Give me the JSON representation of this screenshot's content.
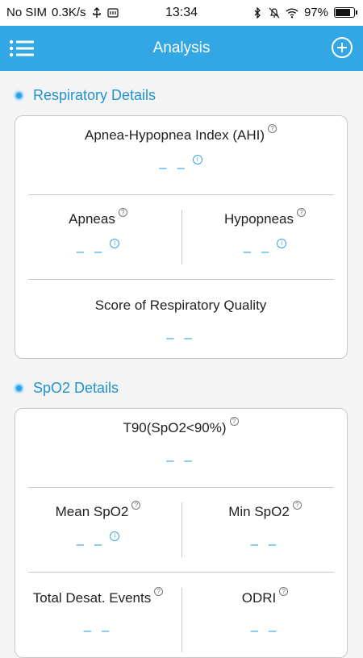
{
  "status_bar": {
    "carrier": "No SIM",
    "speed": "0.3K/s",
    "time": "13:34",
    "battery": "97%"
  },
  "header": {
    "title": "Analysis",
    "menu_icon": "list-menu-icon",
    "add_icon": "plus-circle-icon",
    "background_color": "#33a7e3"
  },
  "respiratory": {
    "section_title": "Respiratory Details",
    "ahi_label": "Apnea-Hypopnea Index (AHI)",
    "ahi_value": "– –",
    "apneas_label": "Apneas",
    "apneas_value": "– –",
    "hypopneas_label": "Hypopneas",
    "hypopneas_value": "– –",
    "score_label": "Score of Respiratory Quality",
    "score_value": "– –"
  },
  "spo2": {
    "section_title": "SpO2 Details",
    "t90_label": "T90(SpO2<90%)",
    "t90_value": "– –",
    "mean_label": "Mean SpO2",
    "mean_value": "– –",
    "min_label": "Min SpO2",
    "min_value": "– –",
    "desat_label": "Total Desat. Events",
    "desat_value": "– –",
    "odri_label": "ODRI",
    "odri_value": "– –"
  },
  "glyphs": {
    "question": "?",
    "info": "i"
  }
}
